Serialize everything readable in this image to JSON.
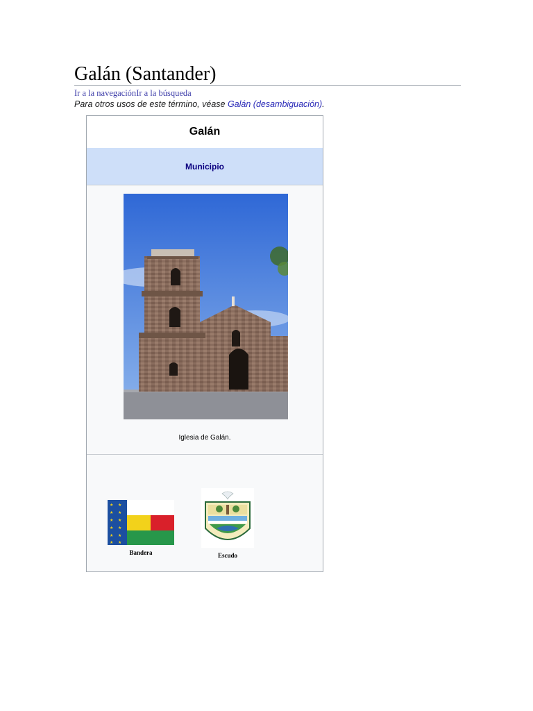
{
  "article": {
    "title": "Galán (Santander)",
    "jump_navigation": "Ir a la navegación",
    "jump_search": "Ir a la búsqueda",
    "hatnote_prefix": "Para otros usos de este término, véase ",
    "hatnote_link": "Galán (desambiguación)",
    "hatnote_suffix": "."
  },
  "infobox": {
    "title": "Galán",
    "subtitle": "Municipio",
    "image_caption": "Iglesia de Galán.",
    "flag_label": "Bandera",
    "shield_label": "Escudo"
  },
  "colors": {
    "link": "#2a2ab8",
    "subtitle_bg": "#cedff9",
    "infobox_bg": "#f8f9fa",
    "flag_blue": "#1c4fa0",
    "flag_yellow": "#f2d21b",
    "flag_red": "#d9202a",
    "flag_green": "#27974a"
  }
}
